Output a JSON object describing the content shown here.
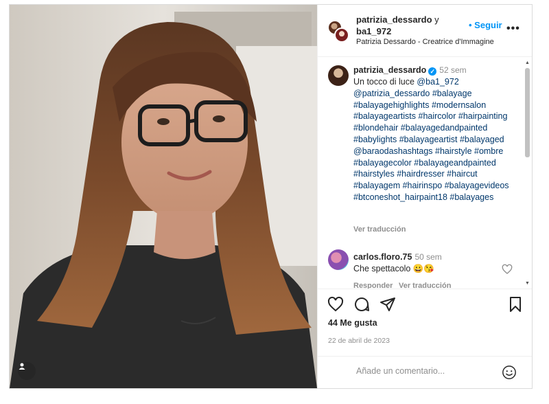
{
  "header": {
    "user1": "patrizia_dessardo",
    "and": "y",
    "user2": "ba1_972",
    "subtitle": "Patrizia Dessardo - Creatrice d'Immagine",
    "follow": "• Seguir",
    "more": "•••"
  },
  "caption": {
    "username": "patrizia_dessardo",
    "time": "52 sem",
    "intro": "Un tocco di luce ",
    "text": "@ba1_972 @patrizia_dessardo #balayage #balayagehighlights #modernsalon #balayageartists #haircolor #hairpainting #blondehair #balayagedandpainted #babylights #balayageartist #balayaged @baraodashashtags #hairstyle #ombre #balayagecolor #balayageandpainted #hairstyles #hairdresser #haircut #balayagem #hairinspo #balayagevideos #btconeshot_hairpaint18 #balayages",
    "see_translation": "Ver traducción"
  },
  "comment": {
    "username": "carlos.floro.75",
    "time": "50 sem",
    "text": "Che spettacolo 😀😘",
    "reply": "Responder",
    "see_translation": "Ver traducción"
  },
  "post": {
    "likes": "44 Me gusta",
    "date": "22 de abril de 2023"
  },
  "add_comment": {
    "placeholder": "Añade un comentario..."
  },
  "icons": [
    "heart-icon",
    "comment-icon",
    "share-icon",
    "bookmark-icon",
    "emoji-icon",
    "user-tag-icon",
    "verified-icon",
    "more-icon"
  ],
  "colors": {
    "accent": "#0095f6",
    "link": "#00376b",
    "muted": "#8e8e8e",
    "border": "#dbdbdb"
  }
}
